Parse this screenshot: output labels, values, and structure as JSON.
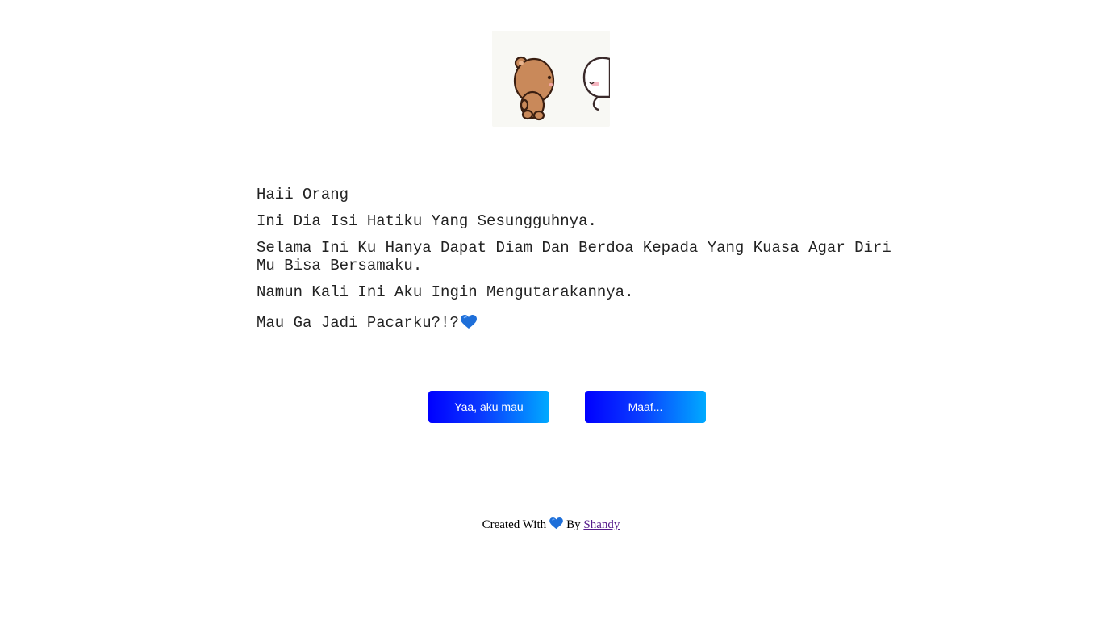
{
  "illustration": {
    "description_icon": "bear-and-bunny-sticker"
  },
  "message": {
    "line1": "Haii Orang",
    "line2": "Ini Dia Isi Hatiku Yang Sesungguhnya.",
    "line3": "Selama Ini Ku Hanya Dapat Diam Dan Berdoa Kepada Yang Kuasa Agar Diri Mu Bisa Bersamaku.",
    "line4": "Namun Kali Ini Aku Ingin Mengutarakannya.",
    "line5": "Mau Ga Jadi Pacarku?!?"
  },
  "buttons": {
    "yes_label": "Yaa, aku mau",
    "no_label": "Maaf..."
  },
  "footer": {
    "prefix": "Created With",
    "by": "By",
    "author": "Shandy"
  },
  "colors": {
    "heart": "#1e6fd9",
    "button_start": "#0000ff",
    "button_end": "#00aaff",
    "link": "#551a8b"
  }
}
